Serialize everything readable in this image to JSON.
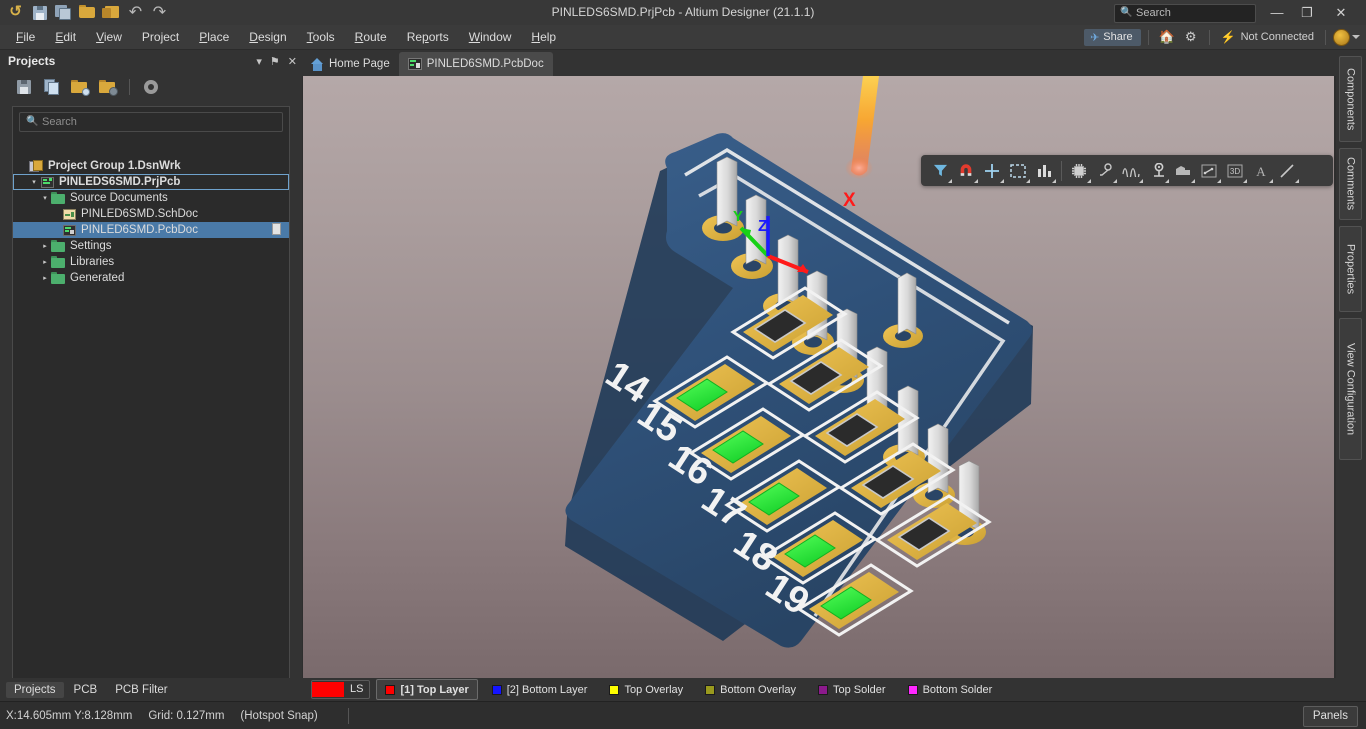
{
  "window": {
    "title": "PINLEDS6SMD.PrjPcb - Altium Designer (21.1.1)",
    "minimize_label": "—",
    "maximize_label": "❐",
    "close_label": "✕"
  },
  "titlebar": {
    "search_placeholder": "Search",
    "icons": [
      "altium-logo-icon",
      "save-icon",
      "save-all-icon",
      "open-folder-icon",
      "open-project-icon",
      "undo-icon",
      "redo-icon"
    ]
  },
  "menubar": {
    "items": [
      {
        "label": "File",
        "accel": "F"
      },
      {
        "label": "Edit",
        "accel": "E"
      },
      {
        "label": "View",
        "accel": "V"
      },
      {
        "label": "Project",
        "accel": "j"
      },
      {
        "label": "Place",
        "accel": "P"
      },
      {
        "label": "Design",
        "accel": "D"
      },
      {
        "label": "Tools",
        "accel": "T"
      },
      {
        "label": "Route",
        "accel": "R"
      },
      {
        "label": "Reports",
        "accel": "p"
      },
      {
        "label": "Window",
        "accel": "W"
      },
      {
        "label": "Help",
        "accel": "H"
      }
    ],
    "share_label": "Share",
    "connection_status": "Not Connected",
    "home_icon": "home-icon",
    "settings_icon": "gear-icon"
  },
  "projects_panel": {
    "title": "Projects",
    "controls": [
      "chevron-down-icon",
      "pin-icon",
      "close-icon"
    ],
    "toolbar_icons": [
      "save-icon",
      "copy-icon",
      "open-project-icon",
      "close-project-icon",
      "gear-icon"
    ],
    "search_placeholder": "Search",
    "tree": [
      {
        "label": "Project Group 1.DsnWrk",
        "icon": "workspace-icon",
        "indent": 0,
        "bold": true,
        "twisty": "",
        "state": "none"
      },
      {
        "label": "PINLEDS6SMD.PrjPcb",
        "icon": "pcb-project-icon",
        "indent": 1,
        "bold": true,
        "twisty": "▾",
        "state": "outline"
      },
      {
        "label": "Source Documents",
        "icon": "folder-icon",
        "indent": 2,
        "bold": false,
        "twisty": "▾",
        "state": "none"
      },
      {
        "label": "PINLED6SMD.SchDoc",
        "icon": "schematic-icon",
        "indent": 3,
        "bold": false,
        "twisty": "",
        "state": "none"
      },
      {
        "label": "PINLED6SMD.PcbDoc",
        "icon": "pcb-doc-icon",
        "indent": 3,
        "bold": false,
        "twisty": "",
        "state": "selected",
        "badge": "document-icon"
      },
      {
        "label": "Settings",
        "icon": "folder-icon",
        "indent": 2,
        "bold": false,
        "twisty": "▸",
        "state": "none"
      },
      {
        "label": "Libraries",
        "icon": "folder-icon",
        "indent": 2,
        "bold": false,
        "twisty": "▸",
        "state": "none"
      },
      {
        "label": "Generated",
        "icon": "folder-icon",
        "indent": 2,
        "bold": false,
        "twisty": "▸",
        "state": "none"
      }
    ],
    "bottom_tabs": [
      {
        "label": "Projects",
        "active": true
      },
      {
        "label": "PCB",
        "active": false
      },
      {
        "label": "PCB Filter",
        "active": false
      }
    ]
  },
  "document_tabs": [
    {
      "label": "Home Page",
      "icon": "home-icon",
      "active": false
    },
    {
      "label": "PINLED6SMD.PcbDoc",
      "icon": "pcb-doc-icon",
      "active": true
    }
  ],
  "viewport_toolbar": {
    "buttons": [
      {
        "name": "filter-icon",
        "tooltip": "Filter"
      },
      {
        "name": "magnet-icon",
        "tooltip": "Snapping"
      },
      {
        "name": "crosshair-icon",
        "tooltip": "Cursor"
      },
      {
        "name": "selection-box-icon",
        "tooltip": "Selection"
      },
      {
        "name": "bar-chart-icon",
        "tooltip": "Layers"
      },
      {
        "name": "ic-chip-icon",
        "tooltip": "Place Component"
      },
      {
        "name": "via-route-icon",
        "tooltip": "Route"
      },
      {
        "name": "wave-icon",
        "tooltip": "Interactive Length Tuning"
      },
      {
        "name": "pad-icon",
        "tooltip": "Place Pad"
      },
      {
        "name": "polygon-pour-icon",
        "tooltip": "Polygon Pour"
      },
      {
        "name": "dimension-icon",
        "tooltip": "Dimension"
      },
      {
        "name": "3d-body-icon",
        "tooltip": "3D Body"
      },
      {
        "name": "text-icon",
        "tooltip": "Place String"
      },
      {
        "name": "line-icon",
        "tooltip": "Place Line"
      }
    ]
  },
  "pcb_3d": {
    "board_color": "#2f5179",
    "pad_color": "#e0b23c",
    "led_color": "#2ef03a",
    "resistor_color": "#252525",
    "pin_color": "#d2d2d2",
    "silkscreen_color": "#f0f0f0",
    "silkscreen_numbers": [
      "14",
      "15",
      "16",
      "17",
      "18",
      "19"
    ],
    "axis_labels": [
      {
        "label": "X",
        "color": "#ff1a1a"
      },
      {
        "label": "Y",
        "color": "#17d117"
      },
      {
        "label": "Z",
        "color": "#1a1aff"
      }
    ],
    "light_cone_color": "#ff9c20",
    "background_top": "#b5a8a8",
    "background_bottom": "#7a6a6c"
  },
  "layer_bar": {
    "ls_swatch_color": "#ff0000",
    "ls_label": "LS",
    "layers": [
      {
        "label": "[1] Top Layer",
        "color": "#ff0000",
        "active": true
      },
      {
        "label": "[2] Bottom Layer",
        "color": "#1414ff",
        "active": false
      },
      {
        "label": "Top Overlay",
        "color": "#ffff00",
        "active": false
      },
      {
        "label": "Bottom Overlay",
        "color": "#9a9a1e",
        "active": false
      },
      {
        "label": "Top Solder",
        "color": "#8c1a8c",
        "active": false
      },
      {
        "label": "Bottom Solder",
        "color": "#ff27ff",
        "active": false
      }
    ]
  },
  "status_bar": {
    "coordinates": "X:14.605mm Y:8.128mm",
    "grid": "Grid: 0.127mm",
    "snap_mode": "(Hotspot Snap)",
    "panels_label": "Panels"
  },
  "right_sidebar": {
    "tabs": [
      "Components",
      "Comments",
      "Properties",
      "View Configuration"
    ]
  }
}
